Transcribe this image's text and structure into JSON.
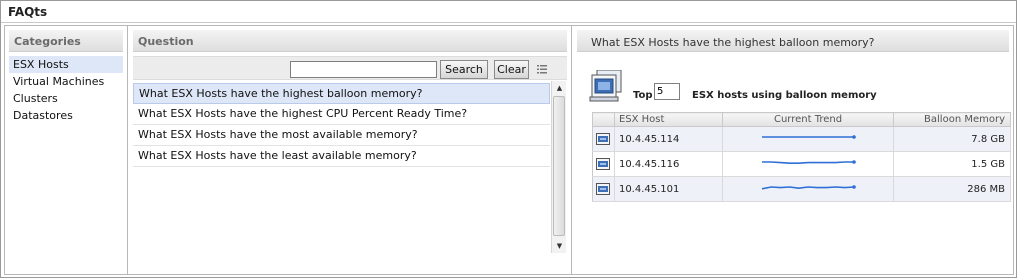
{
  "window": {
    "title": "FAQts"
  },
  "categories": {
    "header": "Categories",
    "items": [
      {
        "label": "ESX Hosts",
        "selected": true
      },
      {
        "label": "Virtual Machines",
        "selected": false
      },
      {
        "label": "Clusters",
        "selected": false
      },
      {
        "label": "Datastores",
        "selected": false
      }
    ]
  },
  "questions": {
    "header": "Question",
    "search_value": "",
    "search_label": "Search",
    "clear_label": "Clear",
    "items": [
      {
        "label": "What ESX Hosts have the highest balloon memory?",
        "selected": true
      },
      {
        "label": "What ESX Hosts have the highest CPU Percent Ready Time?",
        "selected": false
      },
      {
        "label": "What ESX Hosts have the most available memory?",
        "selected": false
      },
      {
        "label": "What ESX Hosts have the least available memory?",
        "selected": false
      }
    ]
  },
  "answer": {
    "header": "What ESX Hosts have the highest balloon memory?",
    "top_label": "Top",
    "top_value": "5",
    "top_suffix": "ESX hosts using balloon memory",
    "columns": {
      "host": "ESX Host",
      "trend": "Current Trend",
      "memory": "Balloon Memory"
    },
    "rows": [
      {
        "host": "10.4.45.114",
        "memory": "7.8 GB",
        "trend": [
          1.0,
          1.0,
          1.0,
          1.0,
          1.0,
          1.0,
          1.0,
          1.0,
          1.0,
          1.0,
          1.0
        ]
      },
      {
        "host": "10.4.45.116",
        "memory": "1.5 GB",
        "trend": [
          1.0,
          1.0,
          0.9,
          0.8,
          0.8,
          0.9,
          0.9,
          0.9,
          0.9,
          1.0,
          1.0
        ]
      },
      {
        "host": "10.4.45.101",
        "memory": "286 MB",
        "trend": [
          0.7,
          1.0,
          0.9,
          1.0,
          0.8,
          1.0,
          0.9,
          0.9,
          1.0,
          0.9,
          1.0
        ]
      }
    ]
  },
  "colors": {
    "selection": "#dde7f7",
    "trend_line": "#2f6fd6",
    "host_icon": "#3c6fb4"
  },
  "icons": {
    "host": "esx-host-icon",
    "column_menu": "column-menu-icon"
  }
}
